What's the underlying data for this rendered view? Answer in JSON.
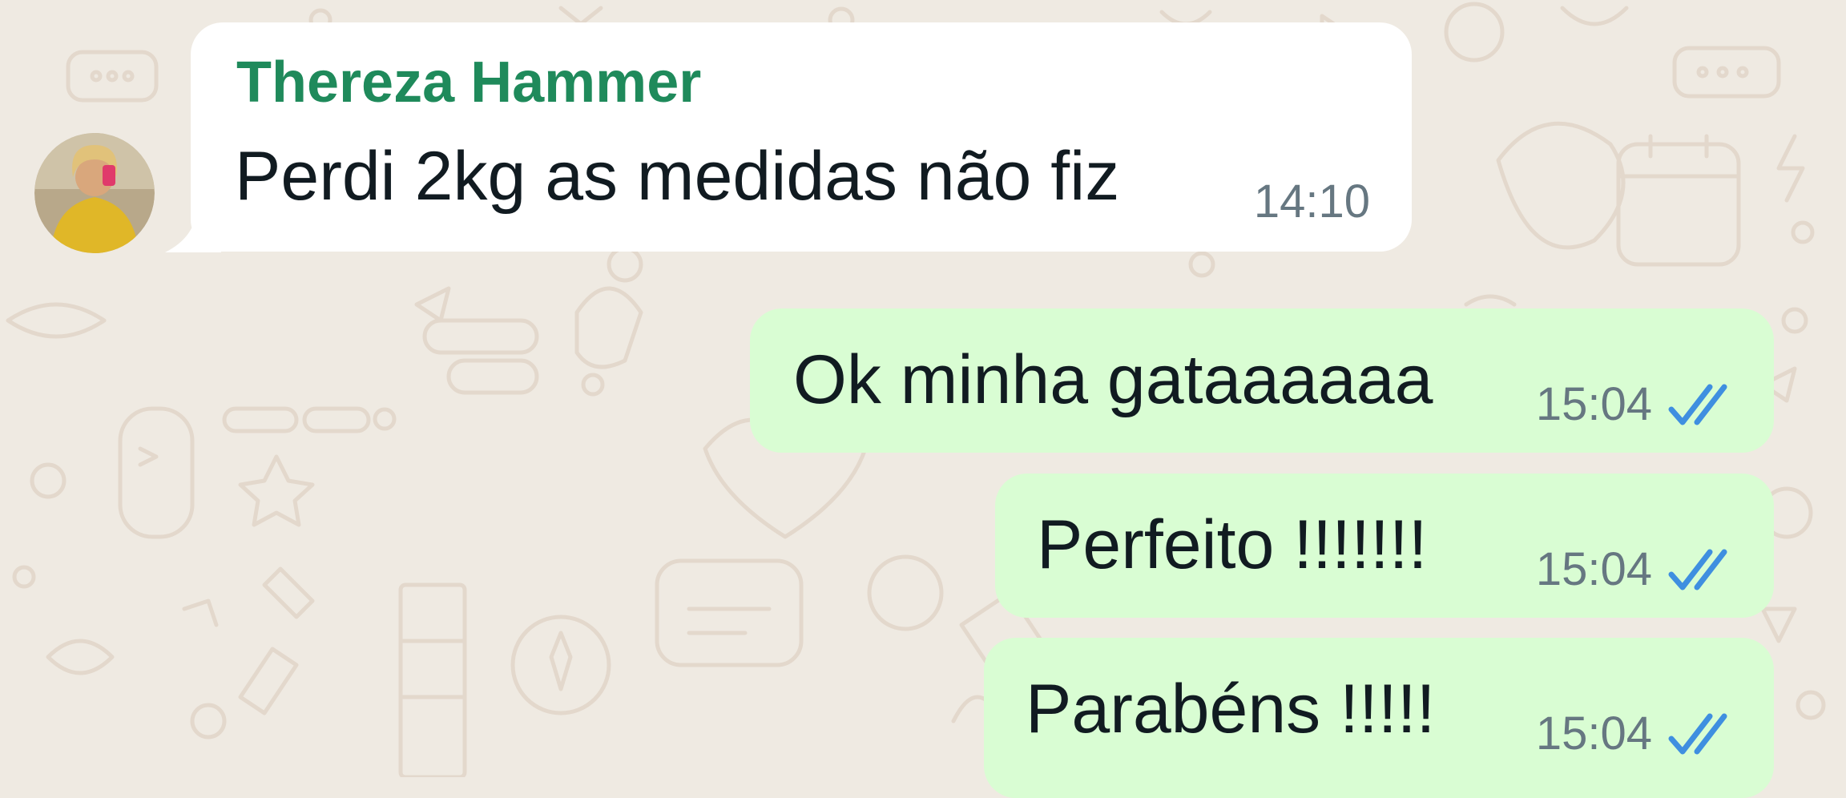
{
  "contact": {
    "name": "Thereza Hammer",
    "avatar_icon": "user-photo-avatar"
  },
  "colors": {
    "background": "#efeae2",
    "incoming_bubble": "#ffffff",
    "outgoing_bubble": "#d9fdd3",
    "sender_name": "#1f8a5b",
    "timestamp": "#667781",
    "read_ticks": "#3f8fe0"
  },
  "messages": [
    {
      "direction": "incoming",
      "sender": "Thereza Hammer",
      "text": "Perdi 2kg as medidas não fiz",
      "time": "14:10"
    },
    {
      "direction": "outgoing",
      "text": "Ok minha gataaaaaa",
      "time": "15:04",
      "status_icon": "double-check-read-icon"
    },
    {
      "direction": "outgoing",
      "text": "Perfeito !!!!!!!",
      "time": "15:04",
      "status_icon": "double-check-read-icon"
    },
    {
      "direction": "outgoing",
      "text": "Parabéns !!!!!",
      "time": "15:04",
      "status_icon": "double-check-read-icon"
    }
  ]
}
